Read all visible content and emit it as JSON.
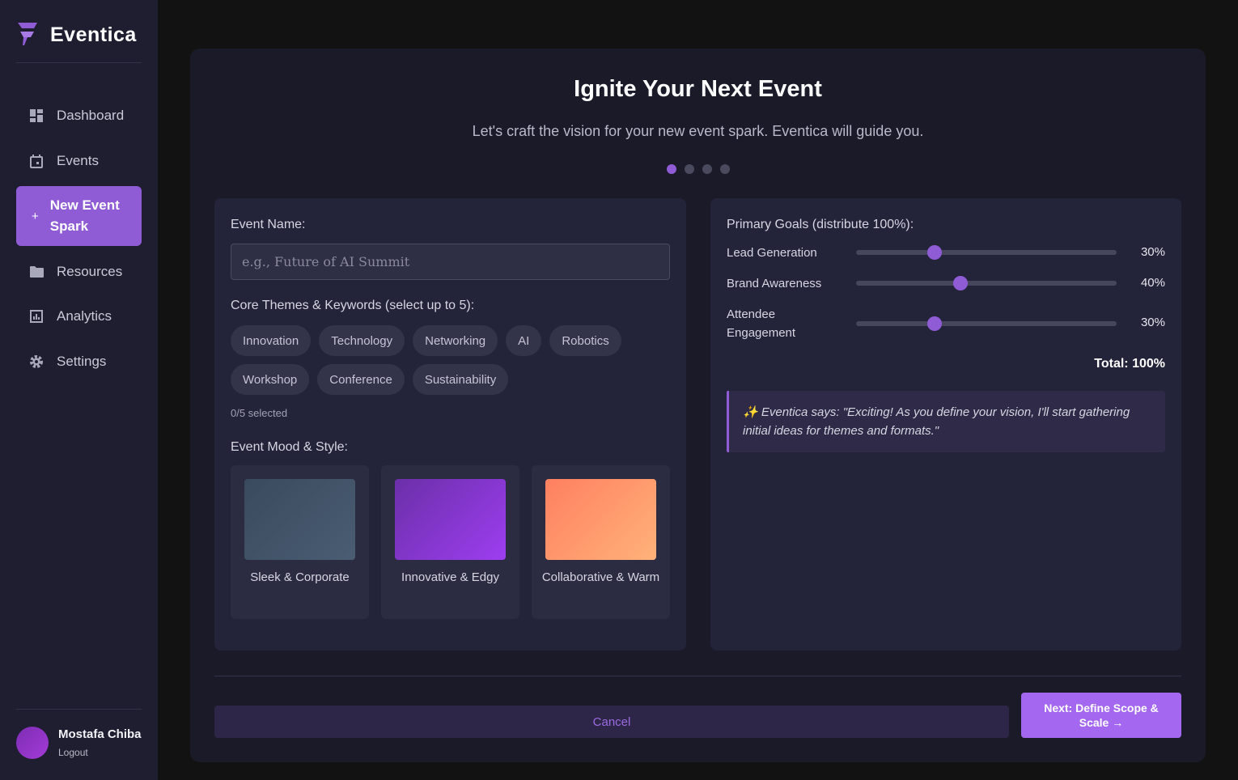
{
  "app": {
    "name": "Eventica"
  },
  "nav": {
    "items": [
      {
        "label": "Dashboard",
        "icon": "dashboard-icon"
      },
      {
        "label": "Events",
        "icon": "calendar-icon"
      },
      {
        "label": "New Event Spark",
        "icon": "plus-icon",
        "active": true
      },
      {
        "label": "Resources",
        "icon": "folder-icon"
      },
      {
        "label": "Analytics",
        "icon": "chart-icon"
      },
      {
        "label": "Settings",
        "icon": "gear-icon"
      }
    ]
  },
  "user": {
    "name": "Mostafa Chiba",
    "logout": "Logout"
  },
  "page": {
    "title": "Ignite Your Next Event",
    "subtitle": "Let's craft the vision for your new event spark. Eventica will guide you.",
    "steps_total": 4,
    "step_current": 1
  },
  "form": {
    "event_name_label": "Event Name:",
    "event_name_placeholder": "e.g., Future of AI Summit",
    "event_name_value": "",
    "themes_label": "Core Themes & Keywords (select up to 5):",
    "themes": [
      "Innovation",
      "Technology",
      "Networking",
      "AI",
      "Robotics",
      "Workshop",
      "Conference",
      "Sustainability"
    ],
    "themes_selected_text": "0/5 selected",
    "mood_label": "Event Mood & Style:",
    "moods": [
      {
        "label": "Sleek & Corporate",
        "gradient": [
          "#3a4a5e",
          "#4a5d72"
        ]
      },
      {
        "label": "Innovative & Edgy",
        "gradient": [
          "#6b2fa8",
          "#9d3ef0"
        ]
      },
      {
        "label": "Collaborative & Warm",
        "gradient": [
          "#ff8060",
          "#ffb27a"
        ]
      }
    ]
  },
  "goals": {
    "label": "Primary Goals (distribute 100%):",
    "items": [
      {
        "label": "Lead Generation",
        "percent": 30,
        "display": "30%"
      },
      {
        "label": "Brand Awareness",
        "percent": 40,
        "display": "40%"
      },
      {
        "label": "Attendee Engagement",
        "percent": 30,
        "display": "30%"
      }
    ],
    "total": "Total: 100%"
  },
  "assistant": {
    "icon": "sparkles-icon",
    "message": "✨ Eventica says: \"Exciting! As you define your vision, I'll start gathering initial ideas for themes and formats.\""
  },
  "actions": {
    "cancel": "Cancel",
    "next": "Next: Define Scope & Scale →"
  },
  "colors": {
    "accent": "#8f5cd6",
    "background": "#121212",
    "sidebar": "#1e1e30",
    "card": "#1a1a28"
  }
}
